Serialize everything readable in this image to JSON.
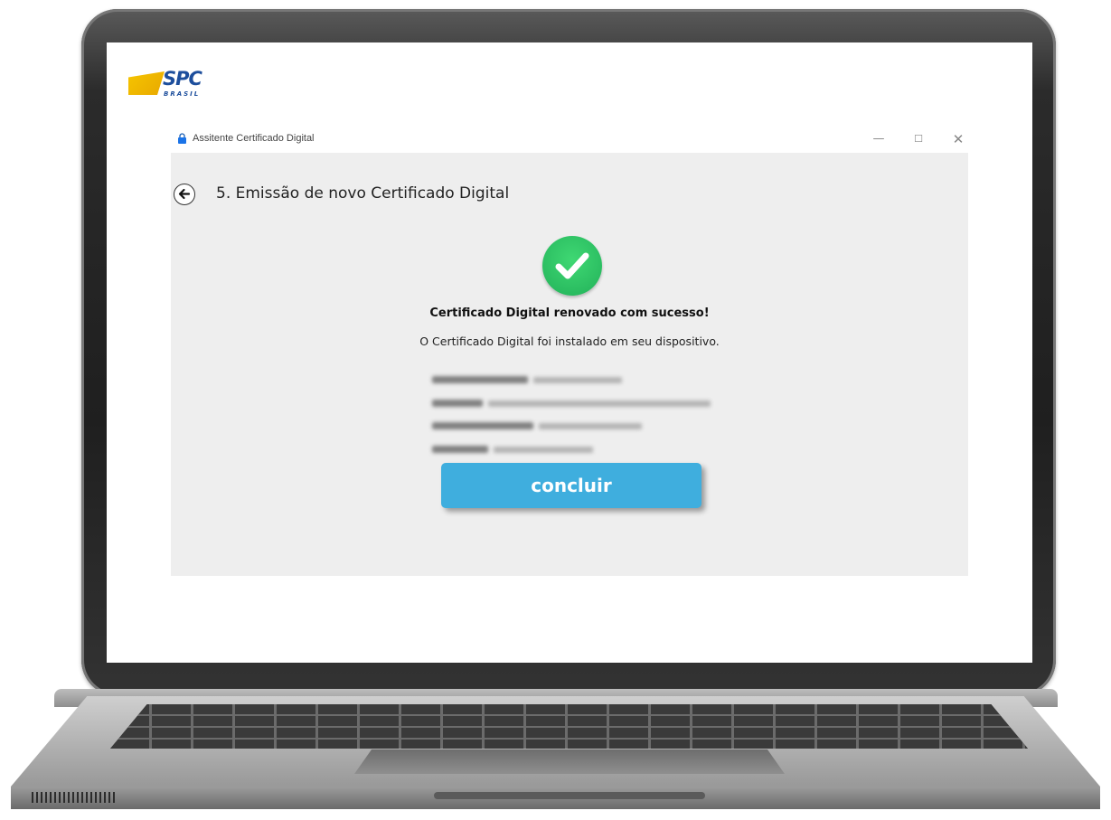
{
  "window": {
    "title": "Assitente Certificado Digital",
    "controls": {
      "minimize": "—",
      "maximize": "☐",
      "close": "✕"
    }
  },
  "brand": {
    "name": "SPC",
    "subtitle": "BRASIL"
  },
  "page": {
    "step_title": "5. Emissão de novo Certificado Digital",
    "success_title": "Certificado Digital renovado com sucesso!",
    "success_message": "O Certificado Digital foi instalado em seu dispositivo."
  },
  "button": {
    "label": "concluir"
  },
  "colors": {
    "success_green": "#2ec866",
    "button_blue": "#3faede",
    "panel_bg": "#eeeeee",
    "brand_blue": "#1d4e9c",
    "brand_yellow": "#f6c500"
  },
  "icons": [
    "lock-icon",
    "arrow-left-icon",
    "check-circle-icon"
  ]
}
